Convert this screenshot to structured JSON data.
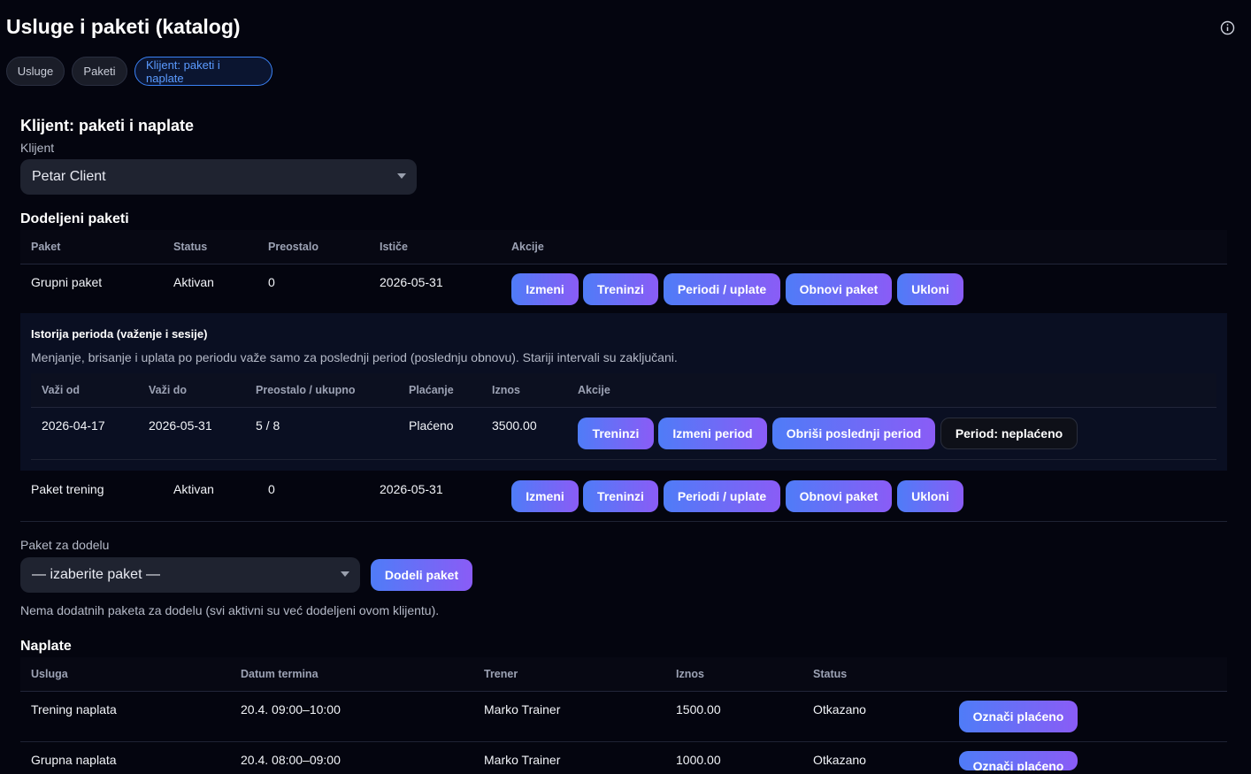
{
  "page": {
    "title": "Usluge i paketi (katalog)"
  },
  "tabs": [
    {
      "label": "Usluge"
    },
    {
      "label": "Paketi"
    },
    {
      "label": "Klijent: paketi i naplate"
    }
  ],
  "client_section": {
    "title": "Klijent: paketi i naplate",
    "client_label": "Klijent",
    "client_value": "Petar Client"
  },
  "assigned": {
    "title": "Dodeljeni paketi",
    "headers": [
      "Paket",
      "Status",
      "Preostalo",
      "Ističe",
      "Akcije"
    ],
    "rows": [
      {
        "name": "Grupni paket",
        "status": "Aktivan",
        "remaining": "0",
        "expires": "2026-05-31"
      },
      {
        "name": "Paket trening",
        "status": "Aktivan",
        "remaining": "0",
        "expires": "2026-05-31"
      }
    ],
    "actions": [
      "Izmeni",
      "Treninzi",
      "Periodi / uplate",
      "Obnovi paket",
      "Ukloni"
    ]
  },
  "history": {
    "title": "Istorija perioda (važenje i sesije)",
    "note": "Menjanje, brisanje i uplata po periodu važe samo za poslednji period (poslednju obnovu). Stariji intervali su zaključani.",
    "headers": [
      "Važi od",
      "Važi do",
      "Preostalo / ukupno",
      "Plaćanje",
      "Iznos",
      "Akcije"
    ],
    "row": {
      "from": "2026-04-17",
      "to": "2026-05-31",
      "remaining": "5 / 8",
      "payment": "Plaćeno",
      "amount": "3500.00"
    },
    "actions": [
      "Treninzi",
      "Izmeni period",
      "Obriši poslednji period",
      "Period: neplaćeno"
    ]
  },
  "assign": {
    "label": "Paket za dodelu",
    "select_value": "— izaberite paket —",
    "button": "Dodeli paket",
    "note": "Nema dodatnih paketa za dodelu (svi aktivni su već dodeljeni ovom klijentu)."
  },
  "billing": {
    "title": "Naplate",
    "headers": [
      "Usluga",
      "Datum termina",
      "Trener",
      "Iznos",
      "Status"
    ],
    "rows": [
      {
        "service": "Trening naplata",
        "date": "20.4. 09:00–10:00",
        "trainer": "Marko Trainer",
        "amount": "1500.00",
        "status": "Otkazano",
        "action": "Označi plaćeno"
      },
      {
        "service": "Grupna naplata",
        "date": "20.4. 08:00–09:00",
        "trainer": "Marko Trainer",
        "amount": "1000.00",
        "status": "Otkazano",
        "action": "Označi plaćeno"
      }
    ]
  },
  "colors": {
    "background": "#04050f",
    "accent_start": "#4f7cf7",
    "accent_end": "#8a5cf6",
    "active_tab": "#3b82f6"
  }
}
